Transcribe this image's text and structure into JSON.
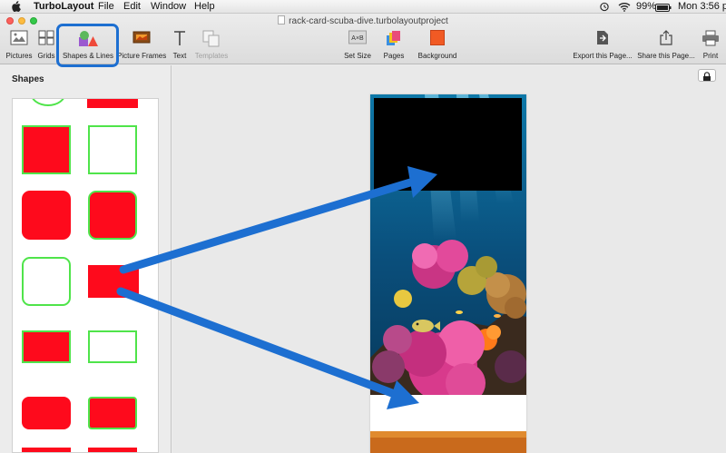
{
  "menubar": {
    "app_name": "TurboLayout",
    "menus": [
      "File",
      "Edit",
      "Window",
      "Help"
    ],
    "battery": "99%",
    "clock": "Mon 3:56 pm"
  },
  "window": {
    "document_title": "rack-card-scuba-dive.turbolayoutproject"
  },
  "toolbar": {
    "pictures": "Pictures",
    "grids": "Grids",
    "shapes_lines": "Shapes & Lines",
    "picture_frames": "Picture Frames",
    "text": "Text",
    "templates": "Templates",
    "set_size": "Set Size",
    "pages": "Pages",
    "background": "Background",
    "export": "Export this Page...",
    "share": "Share this Page...",
    "print": "Print"
  },
  "sidebar": {
    "title": "Shapes"
  },
  "colors": {
    "shape_fill": "#fe0a1c",
    "shape_border": "#4fe44a",
    "annotation": "#1d6fd1",
    "highlight": "#1d6fd1"
  }
}
